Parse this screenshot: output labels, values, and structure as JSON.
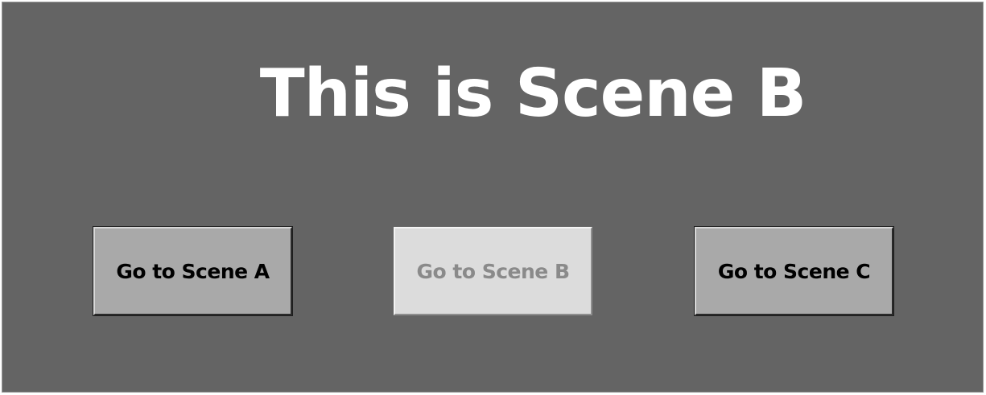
{
  "scene": {
    "title": "This is Scene B"
  },
  "buttons": [
    {
      "label": "Go to Scene A",
      "state": "enabled"
    },
    {
      "label": "Go to Scene B",
      "state": "disabled"
    },
    {
      "label": "Go to Scene C",
      "state": "enabled"
    }
  ],
  "colors": {
    "background": "#646464",
    "title_text": "#ffffff",
    "button_face": "#a9a9a9",
    "button_face_disabled": "#dcdcdc",
    "button_text": "#000000",
    "button_text_disabled": "#8a8a8a"
  }
}
